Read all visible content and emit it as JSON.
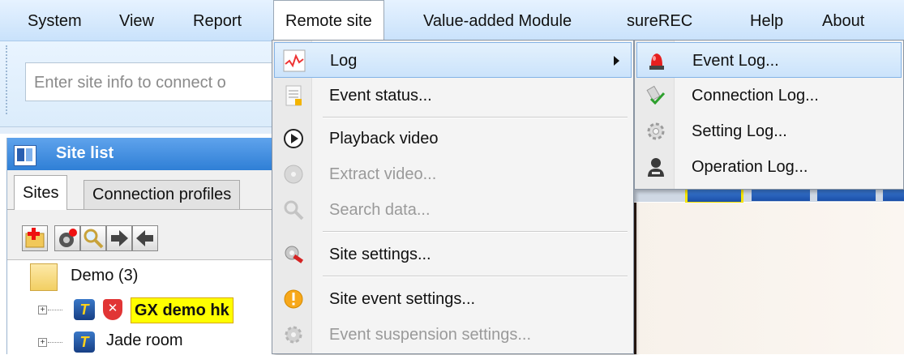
{
  "menubar": {
    "items": [
      "System",
      "View",
      "Report",
      "Remote site",
      "Value-added Module",
      "sureREC",
      "Help",
      "About"
    ]
  },
  "toolbar": {
    "site_input_placeholder": "Enter site info to connect o"
  },
  "site_list": {
    "title": "Site list",
    "tabs": [
      "Sites",
      "Connection profiles"
    ],
    "tree": {
      "group": "Demo (3)",
      "sites": [
        "GX demo hk",
        "Jade room"
      ]
    }
  },
  "remote_site_menu": {
    "items": [
      {
        "label": "Log",
        "icon": "log-chart-icon",
        "enabled": true,
        "has_submenu": true,
        "highlighted": true
      },
      {
        "label": "Event status...",
        "icon": "event-status-icon",
        "enabled": true
      },
      {
        "label": "Playback video",
        "icon": "playback-icon",
        "enabled": true
      },
      {
        "label": "Extract video...",
        "icon": "extract-disc-icon",
        "enabled": false
      },
      {
        "label": "Search data...",
        "icon": "search-magnifier-icon",
        "enabled": false
      },
      {
        "label": "Site settings...",
        "icon": "site-settings-icon",
        "enabled": true
      },
      {
        "label": "Site event settings...",
        "icon": "warning-icon",
        "enabled": true
      },
      {
        "label": "Event suspension settings...",
        "icon": "suspension-gear-icon",
        "enabled": false
      }
    ]
  },
  "log_submenu": {
    "items": [
      {
        "label": "Event Log...",
        "icon": "alarm-light-icon",
        "highlighted": true
      },
      {
        "label": "Connection Log...",
        "icon": "connection-check-icon"
      },
      {
        "label": "Setting Log...",
        "icon": "gear-icon"
      },
      {
        "label": "Operation Log...",
        "icon": "user-icon"
      }
    ]
  },
  "colors": {
    "menubar_bg": "#d6e9fc",
    "highlight": "#cbe3fb",
    "site_header": "#3b8be0",
    "selection_yellow": "#ffff00"
  }
}
